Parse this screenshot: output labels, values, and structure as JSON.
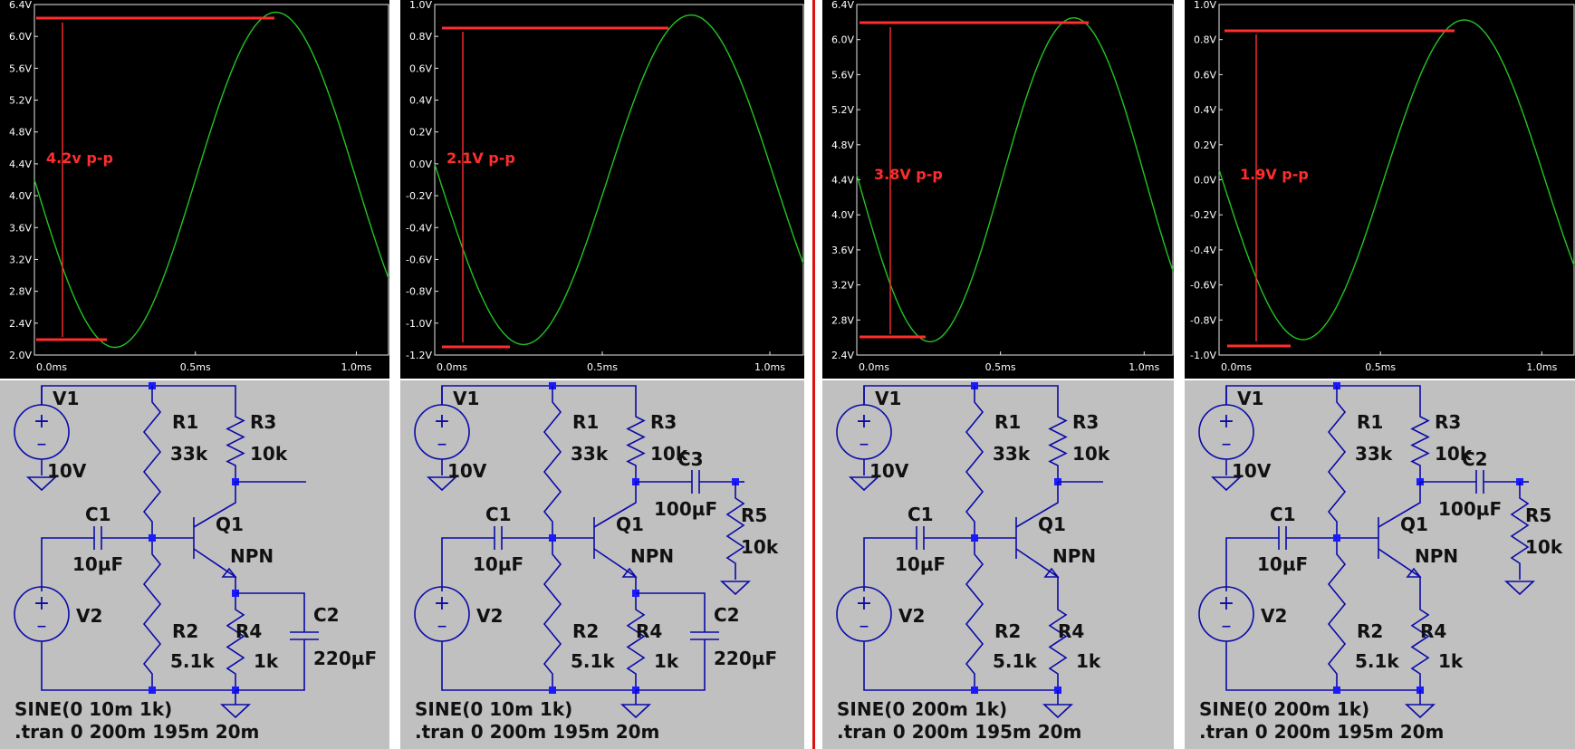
{
  "colors": {
    "plot_bg": "#000000",
    "trace": "#22c422",
    "annotation": "#ff2d2d",
    "schematic_bg": "#c0c0c0",
    "wire": "#0a0aa8",
    "junction": "#1a1aff",
    "divider": "#e01010"
  },
  "panels": [
    {
      "plot": {
        "annotation": "4.2v p-p",
        "y_ticks": [
          "6.4V",
          "6.0V",
          "5.6V",
          "5.2V",
          "4.8V",
          "4.4V",
          "4.0V",
          "3.6V",
          "3.2V",
          "2.8V",
          "2.4V",
          "2.0V"
        ],
        "x_ticks": [
          "0.0ms",
          "0.5ms",
          "1.0ms"
        ]
      },
      "schematic": {
        "labels": {
          "V1": "V1",
          "V1_value": "10V",
          "V2": "V2",
          "R1": "R1",
          "R1_value": "33k",
          "R2": "R2",
          "R2_value": "5.1k",
          "R3": "R3",
          "R3_value": "10k",
          "R4": "R4",
          "R4_value": "1k",
          "C1": "C1",
          "C1_value": "10µF",
          "Q1": "Q1",
          "Q1_type": "NPN",
          "C2": "C2",
          "C2_value": "220µF"
        },
        "source_directive": "SINE(0 10m 1k)",
        "tran_directive": ".tran 0 200m 195m 20m"
      }
    },
    {
      "plot": {
        "annotation": "2.1V p-p",
        "y_ticks": [
          "1.0V",
          "0.8V",
          "0.6V",
          "0.4V",
          "0.2V",
          "0.0V",
          "-0.2V",
          "-0.4V",
          "-0.6V",
          "-0.8V",
          "-1.0V",
          "-1.2V"
        ],
        "x_ticks": [
          "0.0ms",
          "0.5ms",
          "1.0ms"
        ]
      },
      "schematic": {
        "labels": {
          "V1": "V1",
          "V1_value": "10V",
          "V2": "V2",
          "R1": "R1",
          "R1_value": "33k",
          "R2": "R2",
          "R2_value": "5.1k",
          "R3": "R3",
          "R3_value": "10k",
          "R4": "R4",
          "R4_value": "1k",
          "C1": "C1",
          "C1_value": "10µF",
          "Q1": "Q1",
          "Q1_type": "NPN",
          "C2": "C2",
          "C2_value": "220µF",
          "C3": "C3",
          "C3_value": "100µF",
          "R5": "R5",
          "R5_value": "10k"
        },
        "source_directive": "SINE(0 10m 1k)",
        "tran_directive": ".tran 0 200m 195m 20m"
      }
    },
    {
      "plot": {
        "annotation": "3.8V p-p",
        "y_ticks": [
          "6.4V",
          "6.0V",
          "5.6V",
          "5.2V",
          "4.8V",
          "4.4V",
          "4.0V",
          "3.6V",
          "3.2V",
          "2.8V",
          "2.4V"
        ],
        "x_ticks": [
          "0.0ms",
          "0.5ms",
          "1.0ms"
        ]
      },
      "schematic": {
        "labels": {
          "V1": "V1",
          "V1_value": "10V",
          "V2": "V2",
          "R1": "R1",
          "R1_value": "33k",
          "R2": "R2",
          "R2_value": "5.1k",
          "R3": "R3",
          "R3_value": "10k",
          "R4": "R4",
          "R4_value": "1k",
          "C1": "C1",
          "C1_value": "10µF",
          "Q1": "Q1",
          "Q1_type": "NPN"
        },
        "source_directive": "SINE(0 200m 1k)",
        "tran_directive": ".tran 0 200m 195m 20m"
      }
    },
    {
      "plot": {
        "annotation": "1.9V p-p",
        "y_ticks": [
          "1.0V",
          "0.8V",
          "0.6V",
          "0.4V",
          "0.2V",
          "0.0V",
          "-0.2V",
          "-0.4V",
          "-0.6V",
          "-0.8V",
          "-1.0V"
        ],
        "x_ticks": [
          "0.0ms",
          "0.5ms",
          "1.0ms"
        ]
      },
      "schematic": {
        "labels": {
          "V1": "V1",
          "V1_value": "10V",
          "V2": "V2",
          "R1": "R1",
          "R1_value": "33k",
          "R2": "R2",
          "R2_value": "5.1k",
          "R3": "R3",
          "R3_value": "10k",
          "R4": "R4",
          "R4_value": "1k",
          "C1": "C1",
          "C1_value": "10µF",
          "Q1": "Q1",
          "Q1_type": "NPN",
          "C2": "C2",
          "C2_value": "100µF",
          "R5": "R5",
          "R5_value": "10k"
        },
        "source_directive": "SINE(0 200m 1k)",
        "tran_directive": ".tran 0 200m 195m 20m"
      }
    }
  ]
}
